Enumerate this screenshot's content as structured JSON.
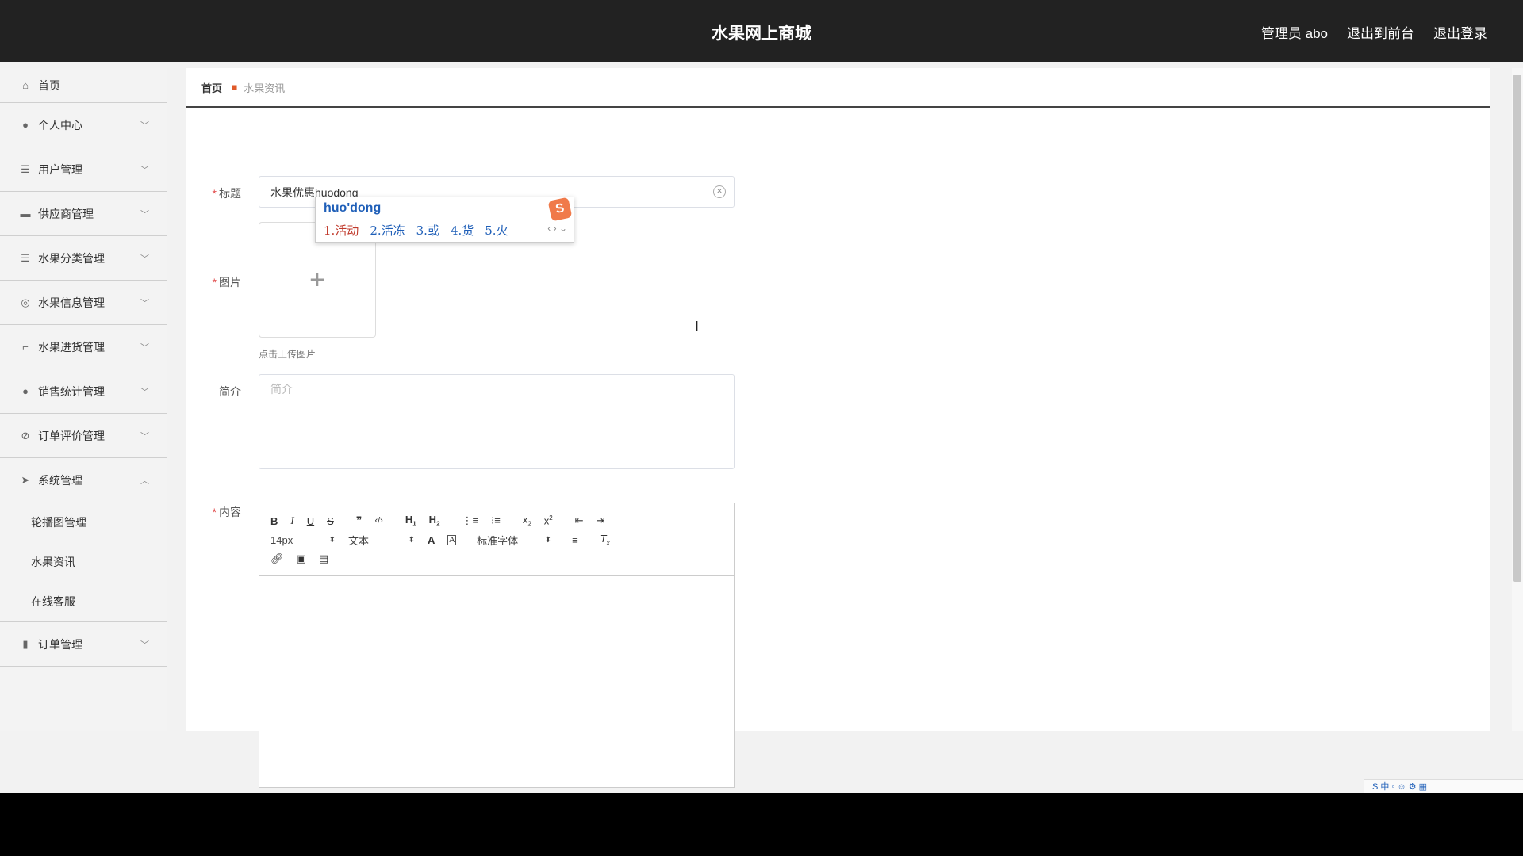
{
  "header": {
    "site_title": "水果网上商城",
    "admin_label": "管理员 abo",
    "front_link": "退出到前台",
    "logout_link": "退出登录"
  },
  "sidebar": {
    "items": [
      {
        "label": "首页",
        "icon": "home-icon"
      },
      {
        "label": "个人中心",
        "icon": "user-icon"
      },
      {
        "label": "用户管理",
        "icon": "list-icon"
      },
      {
        "label": "供应商管理",
        "icon": "box-icon"
      },
      {
        "label": "水果分类管理",
        "icon": "list-icon"
      },
      {
        "label": "水果信息管理",
        "icon": "compass-icon"
      },
      {
        "label": "水果进货管理",
        "icon": "crop-icon"
      },
      {
        "label": "销售统计管理",
        "icon": "leaf-icon"
      },
      {
        "label": "订单评价管理",
        "icon": "compass-off-icon"
      },
      {
        "label": "系统管理",
        "icon": "send-icon"
      },
      {
        "label": "订单管理",
        "icon": "bar-chart-icon"
      }
    ],
    "system_sub": [
      "轮播图管理",
      "水果资讯",
      "在线客服"
    ]
  },
  "breadcrumb": {
    "home": "首页",
    "current": "水果资讯"
  },
  "form": {
    "title_label": "标题",
    "title_value": "水果优惠huodong",
    "image_label": "图片",
    "upload_tip": "点击上传图片",
    "intro_label": "简介",
    "intro_placeholder": "简介",
    "content_label": "内容"
  },
  "editor": {
    "font_size": "14px",
    "block_format": "文本",
    "font_family": "标准字体"
  },
  "ime": {
    "pinyin": "huo'dong",
    "candidates": [
      "1.活动",
      "2.活冻",
      "3.或",
      "4.货",
      "5.火"
    ]
  }
}
